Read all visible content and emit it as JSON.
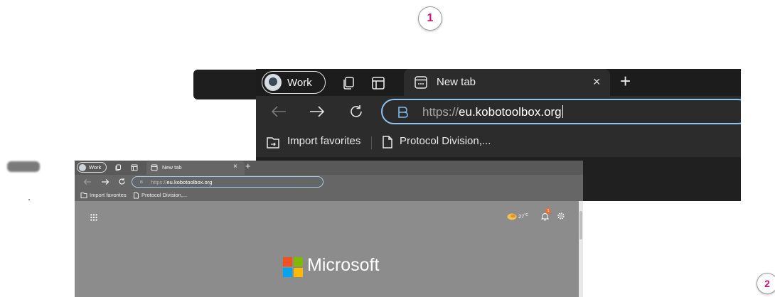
{
  "steps": [
    "1",
    "2"
  ],
  "zoomed_browser": {
    "profile_label": "Work",
    "tab_title": "New tab",
    "tab_close": "×",
    "new_tab": "+",
    "url_prefix": "https://",
    "url_domain": "eu.kobotoolbox.org",
    "favorites": [
      "Import favorites",
      "Protocol Division,..."
    ]
  },
  "small_browser": {
    "profile_label": "Work",
    "tab_title": "New tab",
    "tab_close": "×",
    "new_tab": "+",
    "url_prefix": "https://",
    "url_domain": "eu.kobotoolbox.org",
    "favorites": [
      "Import favorites",
      "Protocol Division,..."
    ],
    "weather_temp": "27",
    "weather_unit": "°C",
    "notification_count": "1",
    "logo_text": "Microsoft"
  },
  "icons": {
    "workspaces": "workspaces-icon",
    "tab_actions": "tab-actions-icon",
    "back": "back-arrow-icon",
    "forward": "forward-arrow-icon",
    "refresh": "refresh-icon",
    "site_info": "site-info-icon",
    "apps": "apps-grid-icon",
    "weather": "weather-icon",
    "notifications": "bell-icon",
    "settings": "gear-icon"
  },
  "colors": {
    "step_number": "#c4167a",
    "url_focus_border": "#8fc3f0",
    "dark_frame": "#202020",
    "ms_red": "#f25022",
    "ms_green": "#7fba00",
    "ms_blue": "#00a4ef",
    "ms_yellow": "#ffb900"
  }
}
